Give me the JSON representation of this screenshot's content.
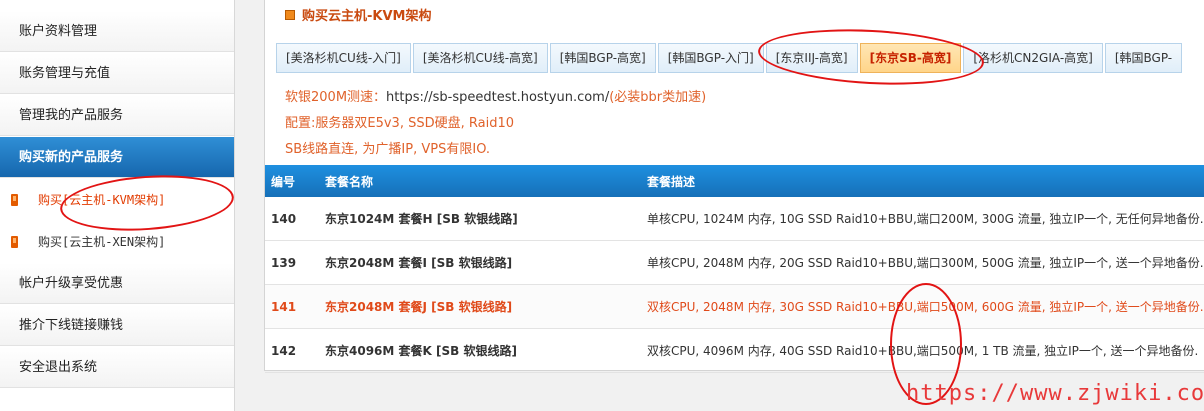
{
  "sidebar": {
    "items": [
      {
        "label": "账户资料管理"
      },
      {
        "label": "账务管理与充值"
      },
      {
        "label": "管理我的产品服务"
      },
      {
        "label": "购买新的产品服务"
      },
      {
        "label": "购买[云主机-KVM架构]"
      },
      {
        "label": "购买[云主机-XEN架构]"
      },
      {
        "label": "帐户升级享受优惠"
      },
      {
        "label": "推介下线链接赚钱"
      },
      {
        "label": "安全退出系统"
      }
    ]
  },
  "panel": {
    "title": "购买云主机-KVM架构"
  },
  "tabs": [
    {
      "label": "[美洛杉机CU线-入门]"
    },
    {
      "label": "[美洛杉机CU线-高宽]"
    },
    {
      "label": "[韩国BGP-高宽]"
    },
    {
      "label": "[韩国BGP-入门]"
    },
    {
      "label": "[东京IIJ-高宽]"
    },
    {
      "label": "[东京SB-高宽]"
    },
    {
      "label": "[洛杉机CN2GIA-高宽]"
    },
    {
      "label": "[韩国BGP-"
    }
  ],
  "info": {
    "speedtest_prefix": "软银200M测速：",
    "speedtest_url": "https://sb-speedtest.hostyun.com/",
    "speedtest_suffix": "(必装bbr类加速)",
    "config": "配置:服务器双E5v3, SSD硬盘, Raid10",
    "route": "SB线路直连, 为广播IP, VPS有限IO."
  },
  "table": {
    "headers": [
      "编号",
      "套餐名称",
      "套餐描述"
    ],
    "rows": [
      {
        "id": "140",
        "name": "东京1024M 套餐H [SB 软银线路]",
        "desc": "单核CPU, 1024M 内存, 10G SSD Raid10+BBU,端口200M, 300G 流量, 独立IP一个, 无任何异地备份."
      },
      {
        "id": "139",
        "name": "东京2048M 套餐I [SB 软银线路]",
        "desc": "单核CPU, 2048M 内存, 20G SSD Raid10+BBU,端口300M, 500G 流量, 独立IP一个, 送一个异地备份."
      },
      {
        "id": "141",
        "name": "东京2048M 套餐J [SB 软银线路]",
        "desc": "双核CPU, 2048M 内存, 30G SSD Raid10+BBU,端口500M, 600G 流量, 独立IP一个, 送一个异地备份."
      },
      {
        "id": "142",
        "name": "东京4096M 套餐K [SB 软银线路]",
        "desc": "双核CPU, 4096M 内存, 40G SSD Raid10+BBU,端口500M, 1 TB 流量, 独立IP一个, 送一个异地备份."
      }
    ]
  },
  "watermark": "https://www.zjwiki.com",
  "colors": {
    "accent_blue": "#1670b8",
    "highlight_orange": "#e04a1a",
    "annotation_red": "#e21414"
  }
}
